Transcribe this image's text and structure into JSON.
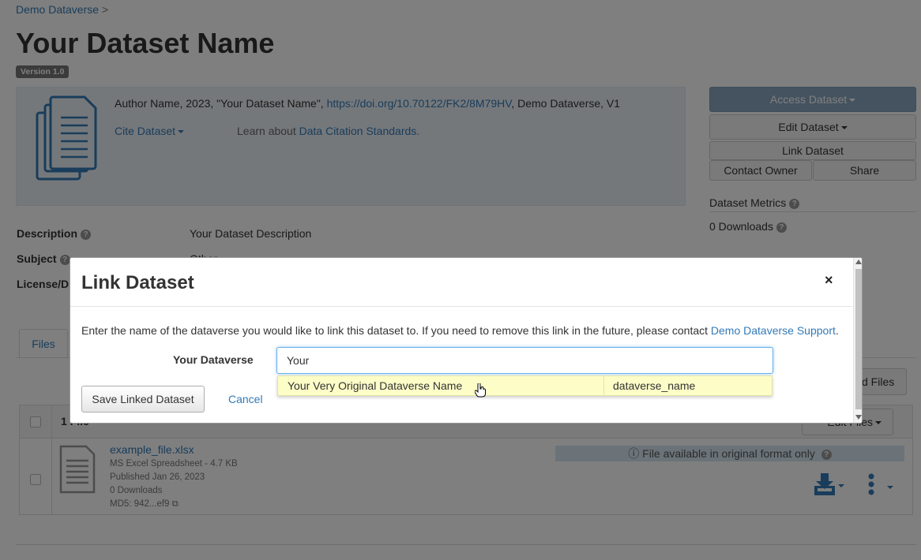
{
  "breadcrumb": {
    "root": "Demo Dataverse",
    "separator": ">"
  },
  "dataset": {
    "title": "Your Dataset Name",
    "version": "Version 1.0",
    "citation_prefix": "Author Name, 2023, \"Your Dataset Name\", ",
    "citation_doi": "https://doi.org/10.70122/FK2/8M79HV",
    "citation_suffix": ", Demo Dataverse, V1",
    "cite_button": "Cite Dataset",
    "learn_prefix": "Learn about ",
    "learn_link": "Data Citation Standards."
  },
  "actions": {
    "access": "Access Dataset",
    "edit": "Edit Dataset",
    "link": "Link Dataset",
    "contact": "Contact Owner",
    "share": "Share"
  },
  "metrics": {
    "title": "Dataset Metrics",
    "downloads": "0 Downloads"
  },
  "metadata": {
    "description_label": "Description",
    "description_value": "Your Dataset Description",
    "subject_label": "Subject",
    "subject_value": "Other",
    "license_label": "License/D"
  },
  "tabs": {
    "files": "Files"
  },
  "files_panel": {
    "upload_label": "d Files",
    "count_label": "1 File",
    "edit_files": "Edit Files",
    "file": {
      "name": "example_file.xlsx",
      "type": "MS Excel Spreadsheet - 4.7 KB",
      "published": "Published Jan 26, 2023",
      "downloads": "0 Downloads",
      "md5": "MD5: 942...ef9"
    },
    "availability": "File available in original format only"
  },
  "modal": {
    "title": "Link Dataset",
    "close": "×",
    "instruction_prefix": "Enter the name of the dataverse you would like to link this dataset to. If you need to remove this link in the future, please contact ",
    "instruction_link": "Demo Dataverse Support",
    "instruction_suffix": ".",
    "field_label": "Your Dataverse",
    "field_value": "Your",
    "suggestion_name": "Your Very Original Dataverse Name",
    "suggestion_alias": "dataverse_name",
    "save_button": "Save Linked Dataset",
    "cancel": "Cancel"
  }
}
